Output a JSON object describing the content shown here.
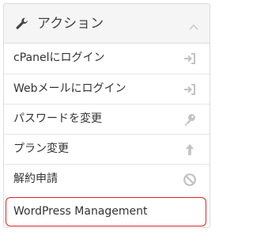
{
  "panel": {
    "title": "アクション",
    "header_icon": "wrench-icon",
    "collapse_icon": "chevron-up-icon"
  },
  "items": [
    {
      "label": "cPanelにログイン",
      "icon": "login-arrow-icon"
    },
    {
      "label": "Webメールにログイン",
      "icon": "login-arrow-icon"
    },
    {
      "label": "パスワードを変更",
      "icon": "key-icon"
    },
    {
      "label": "プラン変更",
      "icon": "arrow-up-icon"
    },
    {
      "label": "解約申請",
      "icon": "ban-icon"
    },
    {
      "label": "WordPress Management",
      "icon": ""
    }
  ],
  "colors": {
    "highlight_border": "#e02525",
    "icon_gray": "#c2c2c2"
  }
}
